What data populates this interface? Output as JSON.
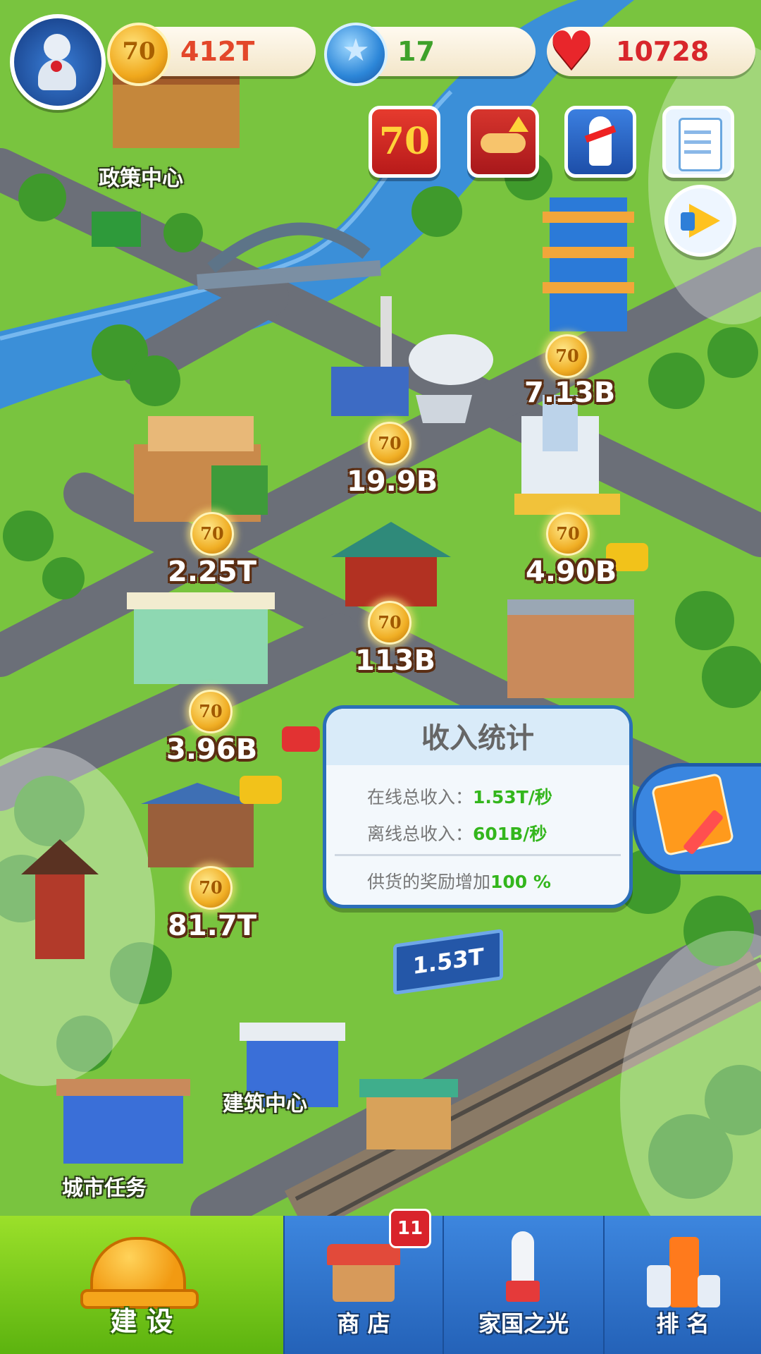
{
  "header": {
    "coins": "412T",
    "stars": "17",
    "hearts": "10728",
    "coin_icon_text": "70"
  },
  "event_icons": [
    {
      "name": "anniversary-70-icon",
      "text": "70"
    },
    {
      "name": "handshake-upgrade-icon"
    },
    {
      "name": "rocket-event-icon"
    },
    {
      "name": "clipboard-task-icon"
    }
  ],
  "places": {
    "policy_center": "政策中心",
    "build_center": "建筑中心",
    "city_tasks": "城市任务"
  },
  "incomes": [
    {
      "id": "tower",
      "value": "7.13B"
    },
    {
      "id": "power-plant",
      "value": "19.9B"
    },
    {
      "id": "lumber-mill",
      "value": "2.25T"
    },
    {
      "id": "tv-station",
      "value": "4.90B"
    },
    {
      "id": "pagoda",
      "value": "113B"
    },
    {
      "id": "trade-center",
      "value": "3.96B"
    },
    {
      "id": "museum",
      "value": "81.7T"
    }
  ],
  "income_stats": {
    "title": "收入统计",
    "online_label": "在线总收入：",
    "online_value": "1.53T/秒",
    "offline_label": "离线总收入：",
    "offline_value": "601B/秒",
    "supply_label": "供货的奖励增加",
    "supply_value": "100 %"
  },
  "billboard": "1.53T",
  "nav": {
    "build": "建 设",
    "shop": "商 店",
    "shop_badge": "11",
    "glory": "家国之光",
    "rank": "排 名"
  },
  "colors": {
    "accent_green": "#33b61c",
    "nav_blue": "#2569c4",
    "coin_red_text": "#e3472a"
  }
}
